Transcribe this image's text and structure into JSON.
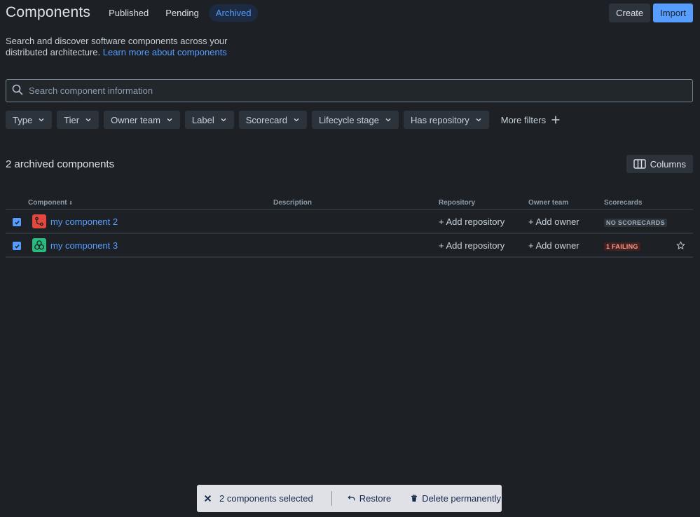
{
  "header": {
    "title": "Components",
    "tabs": [
      {
        "label": "Published"
      },
      {
        "label": "Pending"
      },
      {
        "label": "Archived",
        "active": true
      }
    ],
    "create_label": "Create",
    "import_label": "Import"
  },
  "intro": {
    "text": "Search and discover software components across your distributed architecture.",
    "link": "Learn more about components"
  },
  "search": {
    "placeholder": "Search component information",
    "value": "",
    "icon": "search-icon"
  },
  "filters": [
    {
      "label": "Type"
    },
    {
      "label": "Tier"
    },
    {
      "label": "Owner team"
    },
    {
      "label": "Label"
    },
    {
      "label": "Scorecard"
    },
    {
      "label": "Lifecycle stage"
    },
    {
      "label": "Has repository"
    }
  ],
  "more_filters_label": "More filters",
  "count_label": "2 archived components",
  "columns_label": "Columns",
  "table": {
    "headers": {
      "component": "Component",
      "description": "Description",
      "repository": "Repository",
      "owner_team": "Owner team",
      "scorecards": "Scorecards"
    },
    "rows": [
      {
        "name": "my component 2",
        "icon": "branch-icon",
        "icon_color": "#e2483d",
        "checked": true,
        "description": "",
        "repository": "+ Add repository",
        "owner": "+ Add owner",
        "scorecard": "NO SCORECARDS",
        "scorecard_status": "neutral",
        "starred": false
      },
      {
        "name": "my component 3",
        "icon": "cluster-icon",
        "icon_color": "#2abb7f",
        "checked": true,
        "description": "",
        "repository": "+ Add repository",
        "owner": "+ Add owner",
        "scorecard": "1 FAILING",
        "scorecard_status": "failing",
        "starred": false
      }
    ]
  },
  "action_bar": {
    "selected_label": "2 components selected",
    "restore_label": "Restore",
    "delete_label": "Delete permanently"
  },
  "colors": {
    "background": "#1d2125",
    "accent": "#579dff",
    "link": "#579dff",
    "failing_badge": "#42221f"
  }
}
